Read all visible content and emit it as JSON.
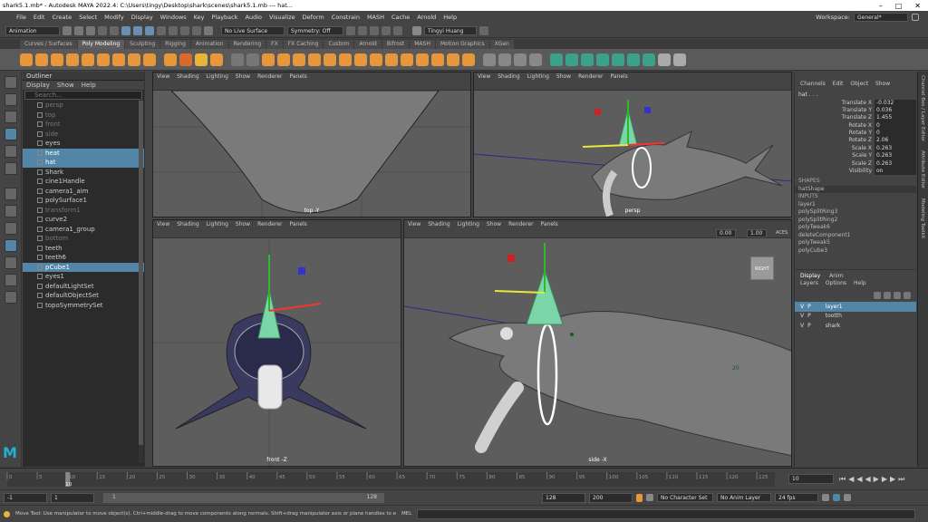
{
  "window": {
    "title": "shark5.1.mb* - Autodesk MAYA 2022.4: C:\\Users\\tingy\\Desktop\\shark\\scenes\\shark5.1.mb   ---   hat..."
  },
  "menubar": {
    "items": [
      "File",
      "Edit",
      "Create",
      "Select",
      "Modify",
      "Display",
      "Windows",
      "Key",
      "Playback",
      "Audio",
      "Visualize",
      "Deform",
      "Constrain",
      "MASH",
      "Cache",
      "Arnold",
      "Help"
    ],
    "workspace_label": "Workspace:",
    "workspace_value": "General*"
  },
  "statusline": {
    "mode": "Animation",
    "live_surface": "No Live Surface",
    "symmetry": "Symmetry: Off",
    "user": "Tingyi Huang"
  },
  "shelf": {
    "tabs": [
      "Curves / Surfaces",
      "Poly Modeling",
      "Sculpting",
      "Rigging",
      "Animation",
      "Rendering",
      "FX",
      "FX Caching",
      "Custom",
      "Arnold",
      "Bifrost",
      "MASH",
      "Motion Graphics",
      "XGen"
    ],
    "active_tab": "Poly Modeling"
  },
  "outliner": {
    "title": "Outliner",
    "menu": [
      "Display",
      "Show",
      "Help"
    ],
    "search_placeholder": "Search...",
    "items": [
      {
        "label": "persp",
        "state": "dim"
      },
      {
        "label": "top",
        "state": "dim"
      },
      {
        "label": "front",
        "state": "dim"
      },
      {
        "label": "side",
        "state": "dim"
      },
      {
        "label": "eyes",
        "state": ""
      },
      {
        "label": "heat",
        "state": "sel"
      },
      {
        "label": "hat",
        "state": "sel"
      },
      {
        "label": "Shark",
        "state": ""
      },
      {
        "label": "cine1Handle",
        "state": ""
      },
      {
        "label": "camera1_aim",
        "state": ""
      },
      {
        "label": "polySurface1",
        "state": ""
      },
      {
        "label": "transform1",
        "state": "dim"
      },
      {
        "label": "curve2",
        "state": ""
      },
      {
        "label": "camera1_group",
        "state": ""
      },
      {
        "label": "bottom",
        "state": "dim"
      },
      {
        "label": "teeth",
        "state": ""
      },
      {
        "label": "teeth6",
        "state": ""
      },
      {
        "label": "pCube1",
        "state": "sel"
      },
      {
        "label": "eyes1",
        "state": ""
      },
      {
        "label": "defaultLightSet",
        "state": ""
      },
      {
        "label": "defaultObjectSet",
        "state": ""
      },
      {
        "label": "topoSymmetrySet",
        "state": ""
      }
    ]
  },
  "viewports": {
    "menu": [
      "View",
      "Shading",
      "Lighting",
      "Show",
      "Renderer",
      "Panels"
    ],
    "top_label": "top -Y",
    "persp_label": "persp",
    "front_label": "front -Z",
    "side_label": "side -X",
    "side_gate": "RIGHT",
    "side_number": "20",
    "side_fields": [
      "0.00",
      "1.00"
    ],
    "side_colorspace": "ACES"
  },
  "channelbox": {
    "menu": [
      "Channels",
      "Edit",
      "Object",
      "Show"
    ],
    "object": "hat . . .",
    "attrs": [
      {
        "k": "Translate X",
        "v": "-0.032"
      },
      {
        "k": "Translate Y",
        "v": "0.036"
      },
      {
        "k": "Translate Z",
        "v": "1.455"
      },
      {
        "k": "Rotate X",
        "v": "0"
      },
      {
        "k": "Rotate Y",
        "v": "0"
      },
      {
        "k": "Rotate Z",
        "v": "2.06"
      },
      {
        "k": "Scale X",
        "v": "0.263"
      },
      {
        "k": "Scale Y",
        "v": "0.263"
      },
      {
        "k": "Scale Z",
        "v": "0.263"
      },
      {
        "k": "Visibility",
        "v": "on"
      }
    ],
    "shapes_label": "SHAPES",
    "shape": "hatShape",
    "inputs_label": "INPUTS",
    "inputs": [
      "layer1",
      "polySplitRing3",
      "polySplitRing2",
      "polyTweak6",
      "deleteComponent1",
      "polyTweak5",
      "polyCube3"
    ]
  },
  "layers": {
    "tabs": [
      "Display",
      "Anim"
    ],
    "menu": [
      "Layers",
      "Options",
      "Help"
    ],
    "rows": [
      {
        "v": "V",
        "p": "P",
        "name": "layer1",
        "sel": true
      },
      {
        "v": "V",
        "p": "P",
        "name": "tootth",
        "sel": false
      },
      {
        "v": "V",
        "p": "P",
        "name": "shark",
        "sel": false
      }
    ]
  },
  "sidetabs": [
    "Channel Box / Layer Editor",
    "Attribute Editor",
    "Modeling Toolkit"
  ],
  "timeline": {
    "ticks": [
      "0",
      "5",
      "10",
      "15",
      "20",
      "25",
      "30",
      "35",
      "40",
      "45",
      "50",
      "55",
      "60",
      "65",
      "70",
      "75",
      "80",
      "85",
      "90",
      "95",
      "100",
      "105",
      "110",
      "115",
      "120",
      "125"
    ],
    "current_frame": "10",
    "current_time_field": "10"
  },
  "range": {
    "start": "-1",
    "anim_start": "1",
    "slider_start": "1",
    "slider_end": "128",
    "end": "128",
    "anim_end": "200",
    "char_set": "No Character Set",
    "anim_layer": "No Anim Layer",
    "fps": "24 fps"
  },
  "helpline": {
    "text": "Move Tool: Use manipulator to move object(s). Ctrl+middle-drag to move components along normals. Shift+drag manipulator axis or plane handles to extrude components or c",
    "mel": "MEL"
  },
  "logo_text": "M"
}
